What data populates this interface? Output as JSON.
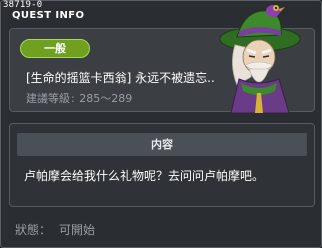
{
  "quest": {
    "id_label": "38719-0",
    "window_title": "QUEST INFO",
    "category": "一般",
    "name": "[生命的摇篮卡西翁] 永远不被遗忘..",
    "level_label": "建議等級",
    "level_sep": ":",
    "level_range": "285～289"
  },
  "npc": {
    "icon": "npc-sage-portrait",
    "colors": {
      "hat": "#3c8a2c",
      "robe": "#6a3b86",
      "hair": "#e8e2da"
    }
  },
  "content": {
    "header": "内容",
    "text": "卢帕摩会给我什么礼物呢？去问问卢帕摩吧。"
  },
  "status": {
    "label": "狀態：",
    "value": "可開始"
  },
  "colors": {
    "window_bg": "#2a2d31",
    "card_bg": "#3b3e43",
    "badge": "#6fa01f",
    "muted_text": "#9a9ea5"
  }
}
